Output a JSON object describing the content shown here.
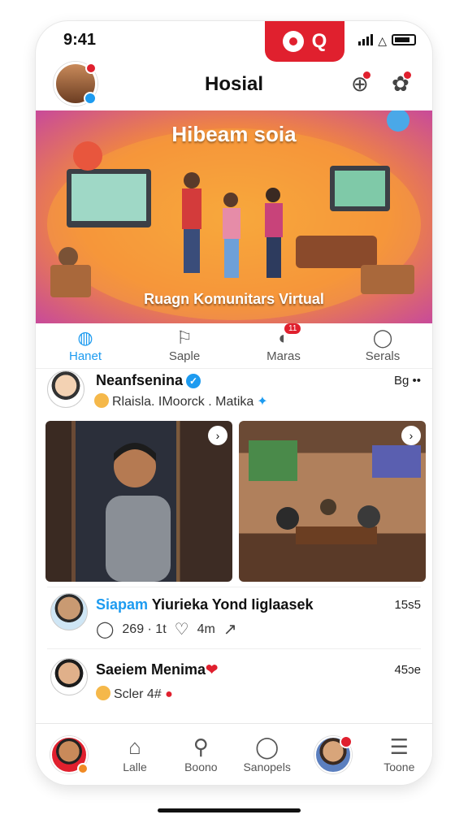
{
  "status": {
    "time": "9:41"
  },
  "header": {
    "title": "Hosial"
  },
  "banner": {
    "title": "Hibeam soia",
    "subtitle": "Ruagn Komunitars Virtual"
  },
  "tabs": [
    {
      "label": "Hanet",
      "icon": "people-icon",
      "active": true
    },
    {
      "label": "Saple",
      "icon": "flag-icon"
    },
    {
      "label": "Maras",
      "icon": "chat-bubble-icon",
      "count": "11"
    },
    {
      "label": "Serals",
      "icon": "person-icon"
    }
  ],
  "posts": [
    {
      "name": "Neanfsenina",
      "subtitle": "Rlaisla. IMoorck . Matika",
      "meta": "Bg ••"
    },
    {
      "name_highlight": "Siapam",
      "name_rest": "Yiurieka Yond Iiglaasek",
      "meta": "15s5",
      "comments": "269 · 1t",
      "likes": "4m"
    },
    {
      "name": "Saeiem Menima",
      "subtitle": "Scler 4#",
      "meta": "45ɔe"
    }
  ],
  "nav": [
    {
      "label": "Lalle",
      "icon": "home-icon"
    },
    {
      "label": "Boono",
      "icon": "search-icon"
    },
    {
      "label": "Sanopels",
      "icon": "person-icon"
    },
    {
      "label": "Toone",
      "icon": "menu-icon"
    }
  ],
  "colors": {
    "accent": "#1d9bf0",
    "brand_red": "#e0202e"
  }
}
